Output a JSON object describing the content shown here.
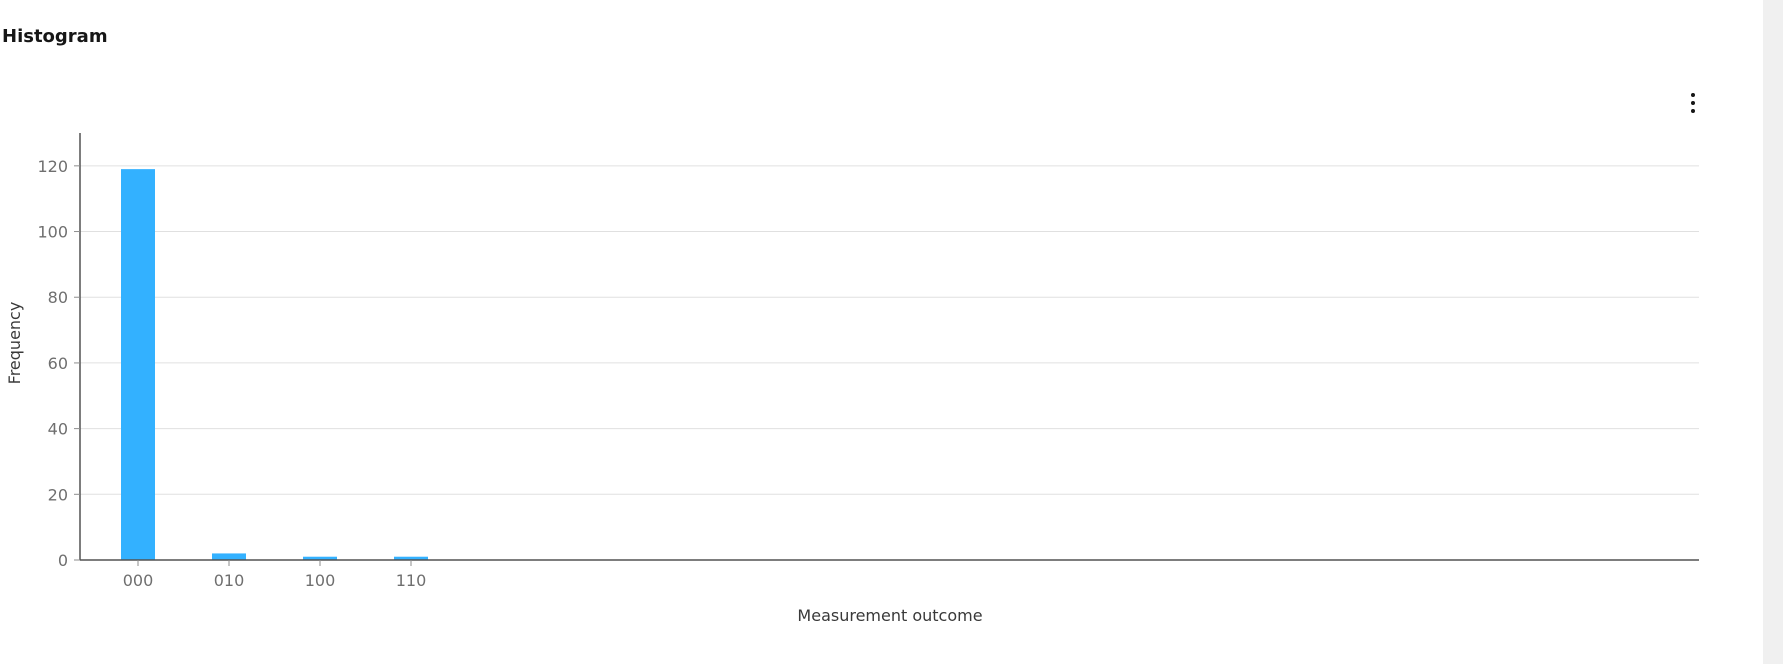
{
  "header": {
    "title": "Histogram"
  },
  "menu": {
    "icon": "overflow-menu-vertical-icon"
  },
  "chart_data": {
    "type": "bar",
    "xlabel": "Measurement outcome",
    "ylabel": "Frequency",
    "categories": [
      "000",
      "010",
      "100",
      "110"
    ],
    "values": [
      119,
      2,
      1,
      1
    ],
    "ylim": [
      0,
      130
    ],
    "yticks": [
      0,
      20,
      40,
      60,
      80,
      100,
      120
    ],
    "grid": true,
    "bar_color": "#33b1ff"
  }
}
